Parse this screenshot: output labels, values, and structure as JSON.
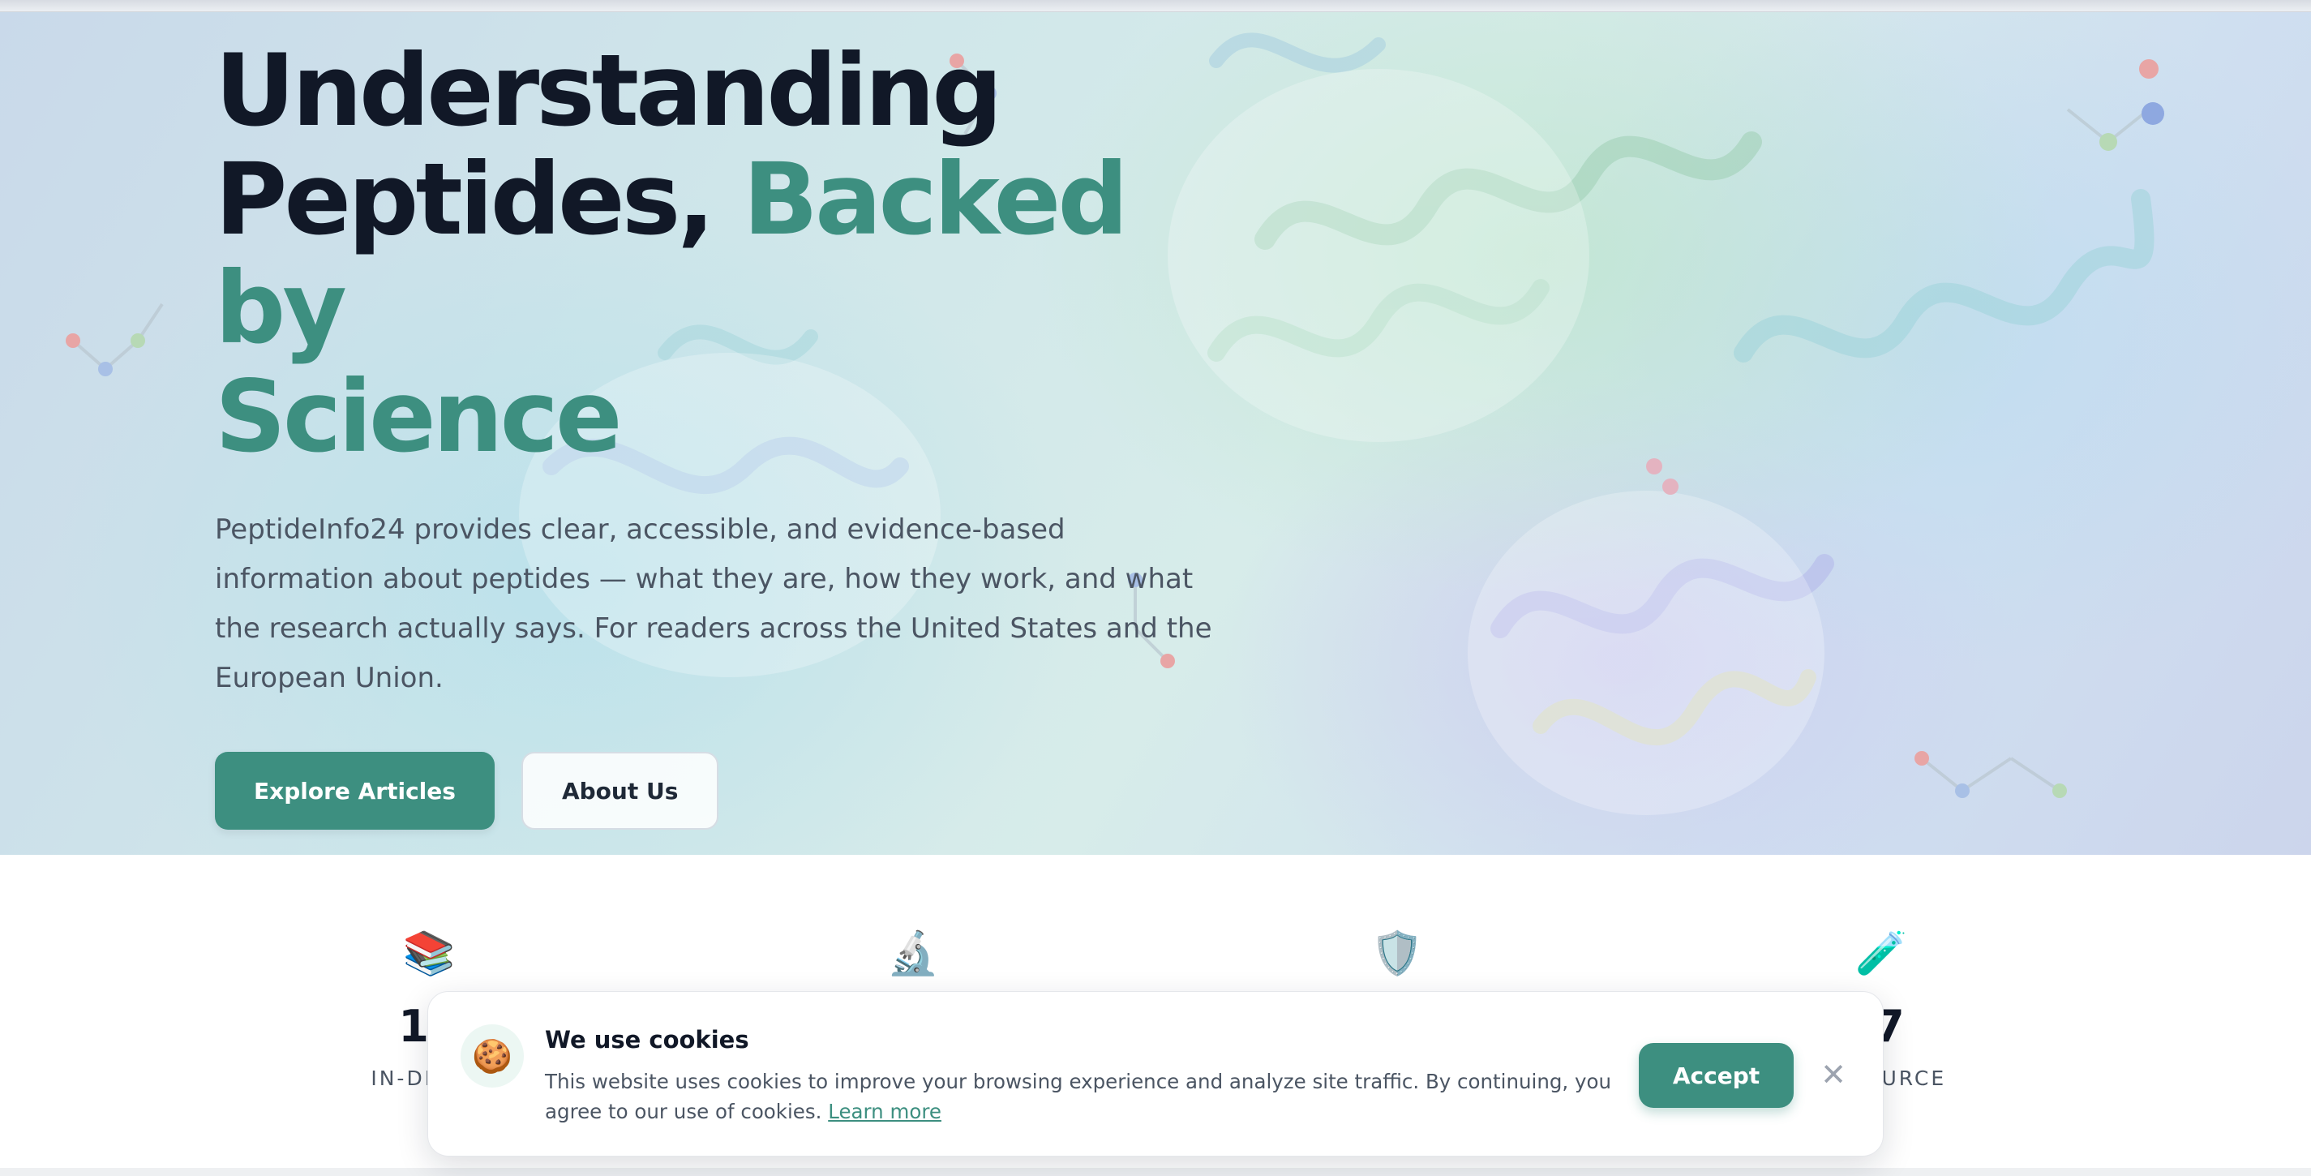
{
  "hero": {
    "title_line1": "Understanding",
    "title_line2": "Peptides,",
    "title_accent_1": "Backed by",
    "title_accent_2": "Science",
    "description": "PeptideInfo24 provides clear, accessible, and evidence-based information about peptides — what they are, how they work, and what the research actually says. For readers across the United States and the European Union.",
    "primary_button": "Explore Articles",
    "secondary_button": "About Us",
    "accent_color": "#3d8f80"
  },
  "stats": [
    {
      "icon": "📚",
      "icon_name": "books-icon",
      "value": "15",
      "label": "IN-DEPTH"
    },
    {
      "icon": "🔬",
      "icon_name": "microscope-icon",
      "value": "",
      "label": ""
    },
    {
      "icon": "🛡️",
      "icon_name": "shield-icon",
      "value": "",
      "label": ""
    },
    {
      "icon": "🧪",
      "icon_name": "test-tube-icon",
      "value": "/7",
      "label": "RESOURCE"
    }
  ],
  "cookie_banner": {
    "icon": "🍪",
    "title": "We use cookies",
    "text": "This website uses cookies to improve your browsing experience and analyze site traffic. By continuing, you agree to our use of cookies.",
    "link": "Learn more",
    "accept": "Accept",
    "close": "✕"
  }
}
